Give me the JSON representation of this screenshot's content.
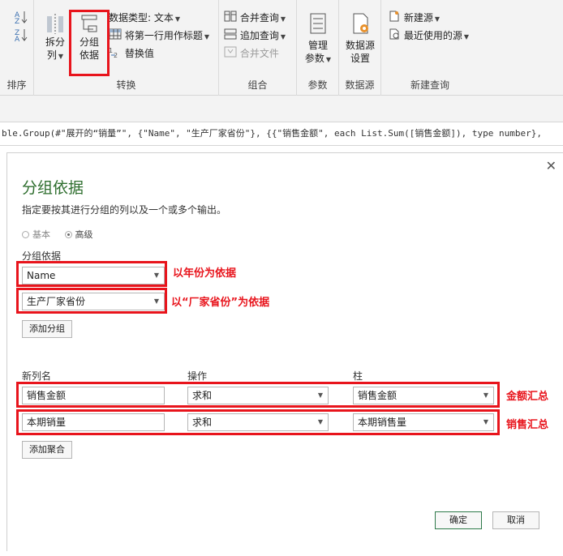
{
  "ribbon": {
    "sort_group": {
      "label": "排序"
    },
    "transform_group": {
      "label": "转换",
      "split_column": {
        "line1": "拆分",
        "line2": "列"
      },
      "group_by": {
        "line1": "分组",
        "line2": "依据"
      },
      "data_type": "数据类型: 文本",
      "first_row_header": "将第一行用作标题",
      "replace_values": "替换值"
    },
    "combine_group": {
      "label": "组合",
      "merge_queries": "合并查询",
      "append_queries": "追加查询",
      "combine_files": "合并文件"
    },
    "params_group": {
      "label": "参数",
      "line1": "管理",
      "line2": "参数"
    },
    "datasource_group": {
      "label": "数据源",
      "line1": "数据源",
      "line2": "设置"
    },
    "newquery_group": {
      "label": "新建查询",
      "new_source": "新建源",
      "recent_sources": "最近使用的源"
    }
  },
  "formula": "ble.Group(#\"展开的“销量”\", {\"Name\", \"生产厂家省份\"}, {{\"销售金额\", each List.Sum([销售金额]), type number},",
  "dialog": {
    "close": "✕",
    "title": "分组依据",
    "subtitle": "指定要按其进行分组的列以及一个或多个输出。",
    "radio_basic": "基本",
    "radio_advanced": "高级",
    "groupby_label": "分组依据",
    "groupby_1": "Name",
    "groupby_2": "生产厂家省份",
    "add_group": "添加分组",
    "col_newname": "新列名",
    "col_operation": "操作",
    "col_column": "柱",
    "rows": [
      {
        "name": "销售金额",
        "operation": "求和",
        "column": "销售金额"
      },
      {
        "name": "本期销量",
        "operation": "求和",
        "column": "本期销售量"
      }
    ],
    "add_aggregation": "添加聚合",
    "ok": "确定",
    "cancel": "取消"
  },
  "annotations": {
    "by_year": "以年份为依据",
    "by_province": "以“厂家省份”为依据",
    "amount_total": "金额汇总",
    "sales_total": "销售汇总"
  },
  "colors": {
    "accent_red": "#e8141c",
    "title_green": "#2e6e2e"
  }
}
